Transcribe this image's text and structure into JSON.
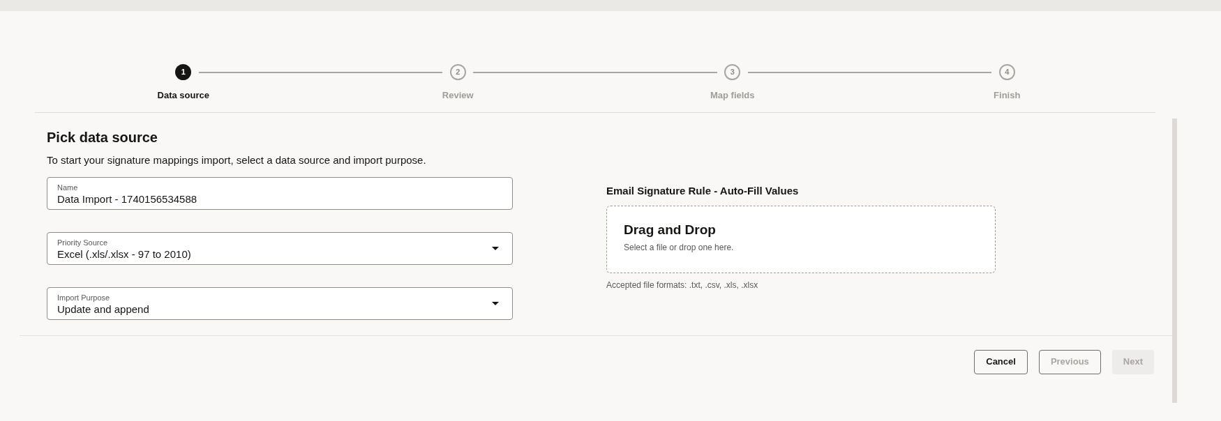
{
  "steps": [
    {
      "number": "1",
      "label": "Data source",
      "selected": true
    },
    {
      "number": "2",
      "label": "Review",
      "selected": false
    },
    {
      "number": "3",
      "label": "Map fields",
      "selected": false
    },
    {
      "number": "4",
      "label": "Finish",
      "selected": false
    }
  ],
  "form": {
    "title": "Pick data source",
    "description": "To start your signature mappings import, select a data source and import purpose.",
    "fields": [
      {
        "kind": "text",
        "label": "Name",
        "value": "Data Import - 1740156534588"
      },
      {
        "kind": "select",
        "label": "Priority Source",
        "value": "Excel (.xls/.xlsx - 97 to 2010)"
      },
      {
        "kind": "select",
        "label": "Import Purpose",
        "value": "Update and append"
      }
    ]
  },
  "upload": {
    "title": "Email Signature Rule - Auto-Fill Values",
    "dropzone_title": "Drag and Drop",
    "dropzone_hint": "Select a file or drop one here.",
    "formats": "Accepted file formats: .txt, .csv, .xls, .xlsx"
  },
  "buttons": [
    {
      "kind": "outline",
      "label": "Cancel",
      "disabled": false
    },
    {
      "kind": "outline",
      "label": "Previous",
      "disabled": true
    },
    {
      "kind": "solid",
      "label": "Next",
      "disabled": true
    }
  ]
}
